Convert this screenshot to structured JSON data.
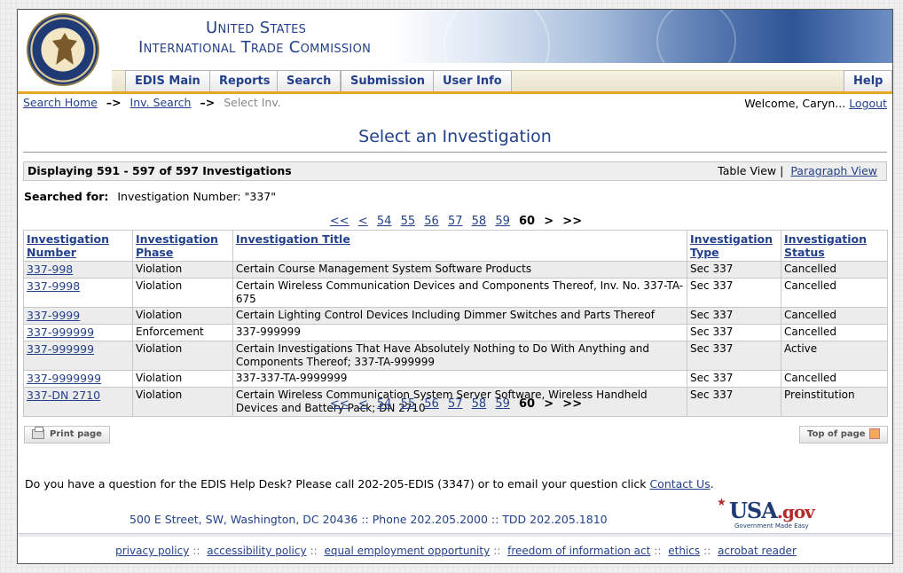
{
  "header": {
    "agency_line1": "United States",
    "agency_line2": "International Trade Commission",
    "nav": [
      "EDIS Main",
      "Reports",
      "Search",
      "Submission",
      "User Info"
    ],
    "help": "Help"
  },
  "breadcrumb": {
    "search_home": "Search Home",
    "inv_search": "Inv. Search",
    "arrow": "–>",
    "current": "Select Inv."
  },
  "welcome": {
    "text": "Welcome, Caryn...",
    "logout": "Logout"
  },
  "page_title": "Select an Investigation",
  "display": {
    "count": "Displaying 591 - 597 of 597 Investigations",
    "table_view": "Table View",
    "separator": "|",
    "paragraph_view": "Paragraph View"
  },
  "searched": {
    "label": "Searched for:",
    "value": "Investigation Number: \"337\""
  },
  "pager": {
    "first": "<<",
    "prev": "<",
    "pages": [
      "54",
      "55",
      "56",
      "57",
      "58",
      "59"
    ],
    "current": "60",
    "next": ">",
    "last": ">>"
  },
  "table": {
    "headers": {
      "number": [
        "Investigation",
        "Number"
      ],
      "phase": [
        "Investigation",
        "Phase"
      ],
      "title": [
        "Investigation Title"
      ],
      "type": [
        "Investigation",
        "Type"
      ],
      "status": [
        "Investigation",
        "Status"
      ]
    },
    "rows": [
      {
        "number": "337-998",
        "phase": "Violation",
        "title": "Certain Course Management System Software Products",
        "type": "Sec 337",
        "status": "Cancelled"
      },
      {
        "number": "337-9998",
        "phase": "Violation",
        "title": "Certain Wireless Communication Devices and Components Thereof, Inv. No. 337-TA-675",
        "type": "Sec 337",
        "status": "Cancelled"
      },
      {
        "number": "337-9999",
        "phase": "Violation",
        "title": "Certain Lighting Control Devices Including Dimmer Switches and Parts Thereof",
        "type": "Sec 337",
        "status": "Cancelled"
      },
      {
        "number": "337-999999",
        "phase": "Enforcement",
        "title": "337-999999",
        "type": "Sec 337",
        "status": "Cancelled"
      },
      {
        "number": "337-999999",
        "phase": "Violation",
        "title": "Certain Investigations That Have Absolutely Nothing to Do With Anything and Components Thereof; 337-TA-999999",
        "type": "Sec 337",
        "status": "Active"
      },
      {
        "number": "337-9999999",
        "phase": "Violation",
        "title": "337-337-TA-9999999",
        "type": "Sec 337",
        "status": "Cancelled"
      },
      {
        "number": "337-DN 2710",
        "phase": "Violation",
        "title": "Certain Wireless Communication System Server Software, Wireless Handheld Devices and Battery Pack; DN 2710",
        "type": "Sec 337",
        "status": "Preinstitution"
      }
    ]
  },
  "buttons": {
    "print": "Print page",
    "top": "Top of page"
  },
  "help_desk": {
    "text": "Do you have a question for the EDIS Help Desk?   Please call 202-205-EDIS (3347) or to email your question click ",
    "link": "Contact Us",
    "end": "."
  },
  "address": "500 E Street, SW, Washington, DC 20436 :: Phone 202.205.2000 :: TDD 202.205.1810",
  "usagov": {
    "usa": "USA",
    "gov": ".gov",
    "tagline": "Government Made Easy"
  },
  "footer": [
    "privacy policy",
    "accessibility policy",
    "equal employment opportunity",
    "freedom of information act",
    "ethics",
    "acrobat reader"
  ],
  "footer_sep": "::"
}
